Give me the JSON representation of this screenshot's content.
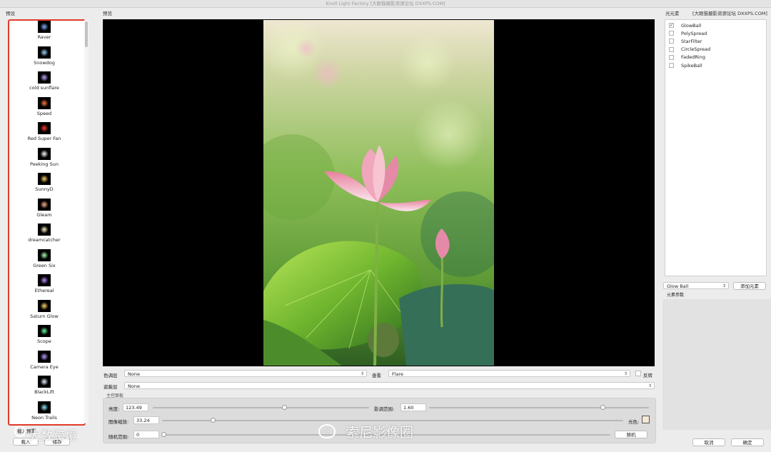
{
  "window": {
    "title": "Knoll Light Factory [大眼猫摄影资源论坛 DXXPS.COM]"
  },
  "left_section_label": "预设",
  "preview_section_label": "预览",
  "right_section_label": "光元素",
  "right_site_label": "[大眼猫摄影资源论坛 DXXPS.COM]",
  "presets": [
    {
      "name": "Raver",
      "color": "#7fb0ff"
    },
    {
      "name": "Snowdog",
      "color": "#9fd8ff"
    },
    {
      "name": "cold sunflare",
      "color": "#c2a6ff"
    },
    {
      "name": "Speed",
      "color": "#ff7a3a"
    },
    {
      "name": "Red Super Fan",
      "color": "#ff3b1f"
    },
    {
      "name": "Peeking Sun",
      "color": "#ffffff"
    },
    {
      "name": "SunnyD",
      "color": "#ffcc66"
    },
    {
      "name": "Gleam",
      "color": "#ffb08a"
    },
    {
      "name": "dreamcatcher",
      "color": "#fff2c2"
    },
    {
      "name": "Green Six",
      "color": "#a8ffb0"
    },
    {
      "name": "Ethereal",
      "color": "#b58cff"
    },
    {
      "name": "Saturn Glow",
      "color": "#ffd36a"
    },
    {
      "name": "Scope",
      "color": "#66ff99"
    },
    {
      "name": "Camera Eye",
      "color": "#b79bff"
    },
    {
      "name": "BlackLift",
      "color": "#e8f4ff"
    },
    {
      "name": "Neon Trails",
      "color": "#8fe6ff"
    }
  ],
  "bottom_left": {
    "label": "载入预置",
    "load_button": "载入",
    "save_button": "储存"
  },
  "controls": {
    "color_layer_label": "色调层",
    "color_layer_value": "None",
    "view_label": "查看",
    "view_value": "Flare",
    "invert_label": "反转",
    "mask_layer_label": "遮蔽层",
    "mask_layer_value": "None",
    "main_panel_label": "主控面板",
    "brightness_label": "亮度:",
    "brightness_value": "123.49",
    "brightness_level": 0.61,
    "influence_label": "影调范围:",
    "influence_value": "1.60",
    "influence_level": 0.79,
    "scale_label": "图像缩放:",
    "scale_value": "33.24",
    "scale_level": 0.11,
    "light_color_label": "光色:",
    "light_color": "#f4e7d7",
    "random_label": "随机范围:",
    "random_value": "0",
    "random_level": 0.0,
    "random_button": "随机"
  },
  "elements": [
    {
      "name": "GlowBall",
      "checked": true
    },
    {
      "name": "PolySpread",
      "checked": false
    },
    {
      "name": "StarFilter",
      "checked": false
    },
    {
      "name": "CircleSpread",
      "checked": false
    },
    {
      "name": "FadedRing",
      "checked": false
    },
    {
      "name": "SpikeBall",
      "checked": false
    }
  ],
  "element_select": {
    "value": "Glow Ball",
    "add_button": "添加元素",
    "params_label": "元素参数"
  },
  "footer_buttons": {
    "cancel": "取消",
    "ok": "确定"
  },
  "watermarks": {
    "left": "大数跨境",
    "center": "索尼影像圈"
  }
}
